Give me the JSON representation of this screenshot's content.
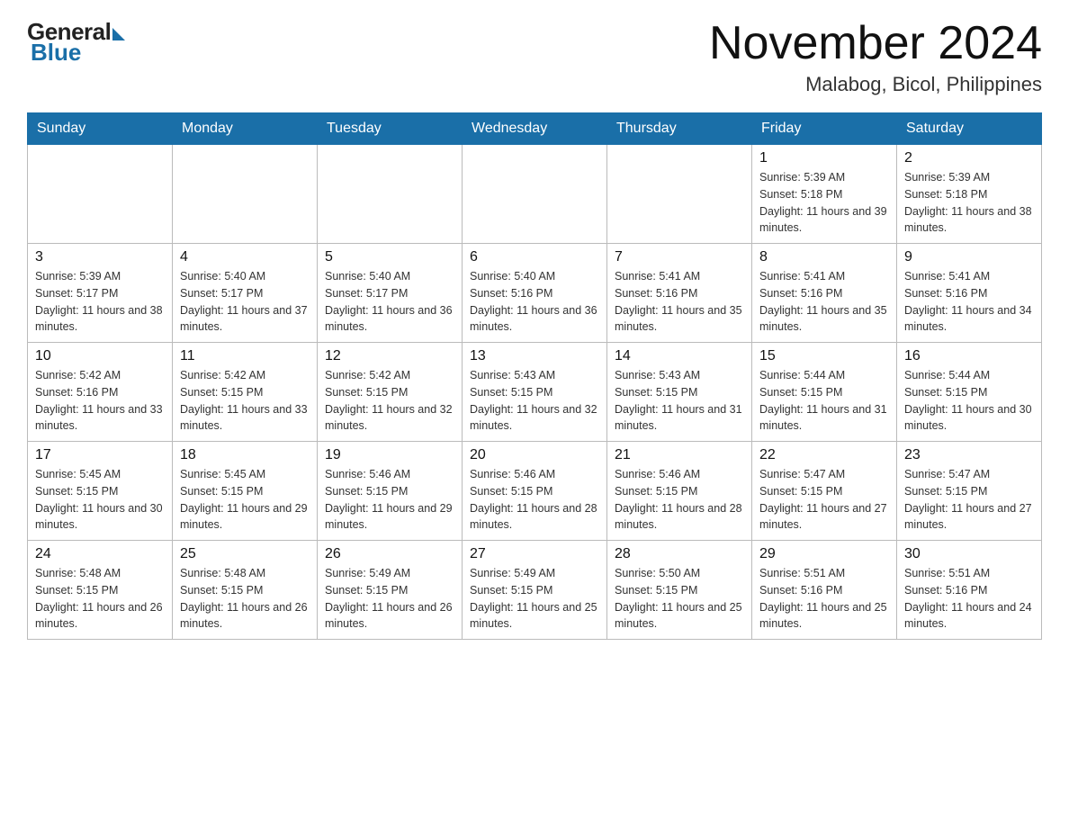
{
  "header": {
    "logo_general": "General",
    "logo_blue": "Blue",
    "title": "November 2024",
    "location": "Malabog, Bicol, Philippines"
  },
  "days_of_week": [
    "Sunday",
    "Monday",
    "Tuesday",
    "Wednesday",
    "Thursday",
    "Friday",
    "Saturday"
  ],
  "weeks": [
    [
      {
        "day": "",
        "sunrise": "",
        "sunset": "",
        "daylight": ""
      },
      {
        "day": "",
        "sunrise": "",
        "sunset": "",
        "daylight": ""
      },
      {
        "day": "",
        "sunrise": "",
        "sunset": "",
        "daylight": ""
      },
      {
        "day": "",
        "sunrise": "",
        "sunset": "",
        "daylight": ""
      },
      {
        "day": "",
        "sunrise": "",
        "sunset": "",
        "daylight": ""
      },
      {
        "day": "1",
        "sunrise": "Sunrise: 5:39 AM",
        "sunset": "Sunset: 5:18 PM",
        "daylight": "Daylight: 11 hours and 39 minutes."
      },
      {
        "day": "2",
        "sunrise": "Sunrise: 5:39 AM",
        "sunset": "Sunset: 5:18 PM",
        "daylight": "Daylight: 11 hours and 38 minutes."
      }
    ],
    [
      {
        "day": "3",
        "sunrise": "Sunrise: 5:39 AM",
        "sunset": "Sunset: 5:17 PM",
        "daylight": "Daylight: 11 hours and 38 minutes."
      },
      {
        "day": "4",
        "sunrise": "Sunrise: 5:40 AM",
        "sunset": "Sunset: 5:17 PM",
        "daylight": "Daylight: 11 hours and 37 minutes."
      },
      {
        "day": "5",
        "sunrise": "Sunrise: 5:40 AM",
        "sunset": "Sunset: 5:17 PM",
        "daylight": "Daylight: 11 hours and 36 minutes."
      },
      {
        "day": "6",
        "sunrise": "Sunrise: 5:40 AM",
        "sunset": "Sunset: 5:16 PM",
        "daylight": "Daylight: 11 hours and 36 minutes."
      },
      {
        "day": "7",
        "sunrise": "Sunrise: 5:41 AM",
        "sunset": "Sunset: 5:16 PM",
        "daylight": "Daylight: 11 hours and 35 minutes."
      },
      {
        "day": "8",
        "sunrise": "Sunrise: 5:41 AM",
        "sunset": "Sunset: 5:16 PM",
        "daylight": "Daylight: 11 hours and 35 minutes."
      },
      {
        "day": "9",
        "sunrise": "Sunrise: 5:41 AM",
        "sunset": "Sunset: 5:16 PM",
        "daylight": "Daylight: 11 hours and 34 minutes."
      }
    ],
    [
      {
        "day": "10",
        "sunrise": "Sunrise: 5:42 AM",
        "sunset": "Sunset: 5:16 PM",
        "daylight": "Daylight: 11 hours and 33 minutes."
      },
      {
        "day": "11",
        "sunrise": "Sunrise: 5:42 AM",
        "sunset": "Sunset: 5:15 PM",
        "daylight": "Daylight: 11 hours and 33 minutes."
      },
      {
        "day": "12",
        "sunrise": "Sunrise: 5:42 AM",
        "sunset": "Sunset: 5:15 PM",
        "daylight": "Daylight: 11 hours and 32 minutes."
      },
      {
        "day": "13",
        "sunrise": "Sunrise: 5:43 AM",
        "sunset": "Sunset: 5:15 PM",
        "daylight": "Daylight: 11 hours and 32 minutes."
      },
      {
        "day": "14",
        "sunrise": "Sunrise: 5:43 AM",
        "sunset": "Sunset: 5:15 PM",
        "daylight": "Daylight: 11 hours and 31 minutes."
      },
      {
        "day": "15",
        "sunrise": "Sunrise: 5:44 AM",
        "sunset": "Sunset: 5:15 PM",
        "daylight": "Daylight: 11 hours and 31 minutes."
      },
      {
        "day": "16",
        "sunrise": "Sunrise: 5:44 AM",
        "sunset": "Sunset: 5:15 PM",
        "daylight": "Daylight: 11 hours and 30 minutes."
      }
    ],
    [
      {
        "day": "17",
        "sunrise": "Sunrise: 5:45 AM",
        "sunset": "Sunset: 5:15 PM",
        "daylight": "Daylight: 11 hours and 30 minutes."
      },
      {
        "day": "18",
        "sunrise": "Sunrise: 5:45 AM",
        "sunset": "Sunset: 5:15 PM",
        "daylight": "Daylight: 11 hours and 29 minutes."
      },
      {
        "day": "19",
        "sunrise": "Sunrise: 5:46 AM",
        "sunset": "Sunset: 5:15 PM",
        "daylight": "Daylight: 11 hours and 29 minutes."
      },
      {
        "day": "20",
        "sunrise": "Sunrise: 5:46 AM",
        "sunset": "Sunset: 5:15 PM",
        "daylight": "Daylight: 11 hours and 28 minutes."
      },
      {
        "day": "21",
        "sunrise": "Sunrise: 5:46 AM",
        "sunset": "Sunset: 5:15 PM",
        "daylight": "Daylight: 11 hours and 28 minutes."
      },
      {
        "day": "22",
        "sunrise": "Sunrise: 5:47 AM",
        "sunset": "Sunset: 5:15 PM",
        "daylight": "Daylight: 11 hours and 27 minutes."
      },
      {
        "day": "23",
        "sunrise": "Sunrise: 5:47 AM",
        "sunset": "Sunset: 5:15 PM",
        "daylight": "Daylight: 11 hours and 27 minutes."
      }
    ],
    [
      {
        "day": "24",
        "sunrise": "Sunrise: 5:48 AM",
        "sunset": "Sunset: 5:15 PM",
        "daylight": "Daylight: 11 hours and 26 minutes."
      },
      {
        "day": "25",
        "sunrise": "Sunrise: 5:48 AM",
        "sunset": "Sunset: 5:15 PM",
        "daylight": "Daylight: 11 hours and 26 minutes."
      },
      {
        "day": "26",
        "sunrise": "Sunrise: 5:49 AM",
        "sunset": "Sunset: 5:15 PM",
        "daylight": "Daylight: 11 hours and 26 minutes."
      },
      {
        "day": "27",
        "sunrise": "Sunrise: 5:49 AM",
        "sunset": "Sunset: 5:15 PM",
        "daylight": "Daylight: 11 hours and 25 minutes."
      },
      {
        "day": "28",
        "sunrise": "Sunrise: 5:50 AM",
        "sunset": "Sunset: 5:15 PM",
        "daylight": "Daylight: 11 hours and 25 minutes."
      },
      {
        "day": "29",
        "sunrise": "Sunrise: 5:51 AM",
        "sunset": "Sunset: 5:16 PM",
        "daylight": "Daylight: 11 hours and 25 minutes."
      },
      {
        "day": "30",
        "sunrise": "Sunrise: 5:51 AM",
        "sunset": "Sunset: 5:16 PM",
        "daylight": "Daylight: 11 hours and 24 minutes."
      }
    ]
  ]
}
